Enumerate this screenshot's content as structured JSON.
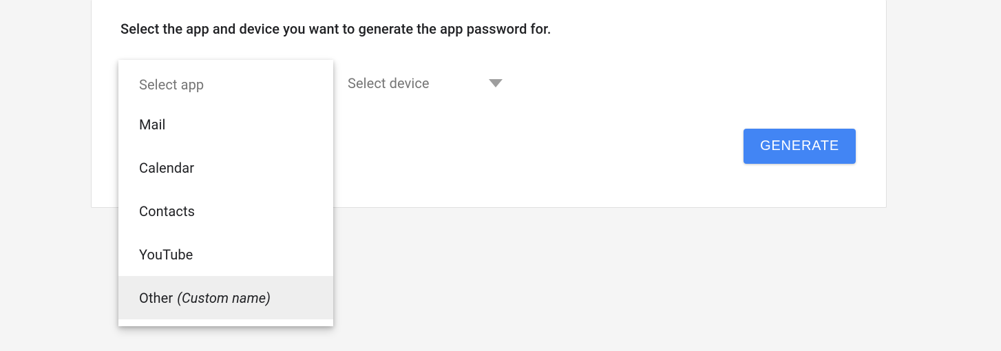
{
  "instruction": "Select the app and device you want to generate the app password for.",
  "app_dropdown": {
    "placeholder": "Select app",
    "options": [
      {
        "label": "Mail"
      },
      {
        "label": "Calendar"
      },
      {
        "label": "Contacts"
      },
      {
        "label": "YouTube"
      },
      {
        "label": "Other",
        "suffix": "(Custom name)",
        "highlighted": true
      }
    ]
  },
  "device_dropdown": {
    "placeholder": "Select device"
  },
  "generate_button_label": "GENERATE"
}
